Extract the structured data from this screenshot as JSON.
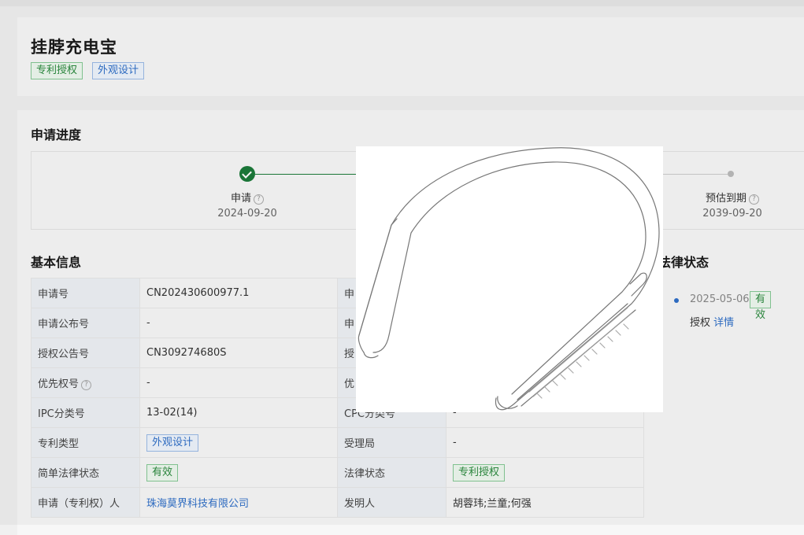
{
  "header": {
    "title": "挂脖充电宝",
    "tags": [
      "专利授权",
      "外观设计"
    ]
  },
  "progress": {
    "section_title": "申请进度",
    "steps": [
      {
        "label": "申请",
        "date": "2024-09-20",
        "status": "done"
      },
      {
        "label": "预估到期",
        "date": "2039-09-20",
        "status": "pending"
      }
    ]
  },
  "basic_info": {
    "section_title": "基本信息",
    "rows": [
      {
        "k1": "申请号",
        "v1": "CN202430600977.1",
        "k2": "申",
        "v2": ""
      },
      {
        "k1": "申请公布号",
        "v1": "-",
        "k2": "申",
        "v2": ""
      },
      {
        "k1": "授权公告号",
        "v1": "CN309274680S",
        "k2": "授",
        "v2": ""
      },
      {
        "k1": "优先权号",
        "v1": "-",
        "k2": "优",
        "v2": ""
      },
      {
        "k1": "IPC分类号",
        "v1": "13-02(14)",
        "k2": "CPC分类号",
        "v2": "-"
      },
      {
        "k1": "专利类型",
        "v1": "外观设计",
        "k2": "受理局",
        "v2": "-"
      },
      {
        "k1": "简单法律状态",
        "v1": "有效",
        "k2": "法律状态",
        "v2": "专利授权"
      },
      {
        "k1": "申请（专利权）人",
        "v1": "珠海莫界科技有限公司",
        "k2": "发明人",
        "v2": "胡蓉玮;兰童;何强"
      }
    ]
  },
  "legal_status": {
    "section_title": "法律状态",
    "partial_title": "法律状态",
    "date": "2025-05-06",
    "badge": "有效",
    "desc": "授权",
    "detail_link": "详情"
  },
  "colors": {
    "green": "#1c7a3a",
    "blue": "#2f6fc8"
  },
  "modal": {
    "image": "neck-power-bank-drawing-icon"
  }
}
